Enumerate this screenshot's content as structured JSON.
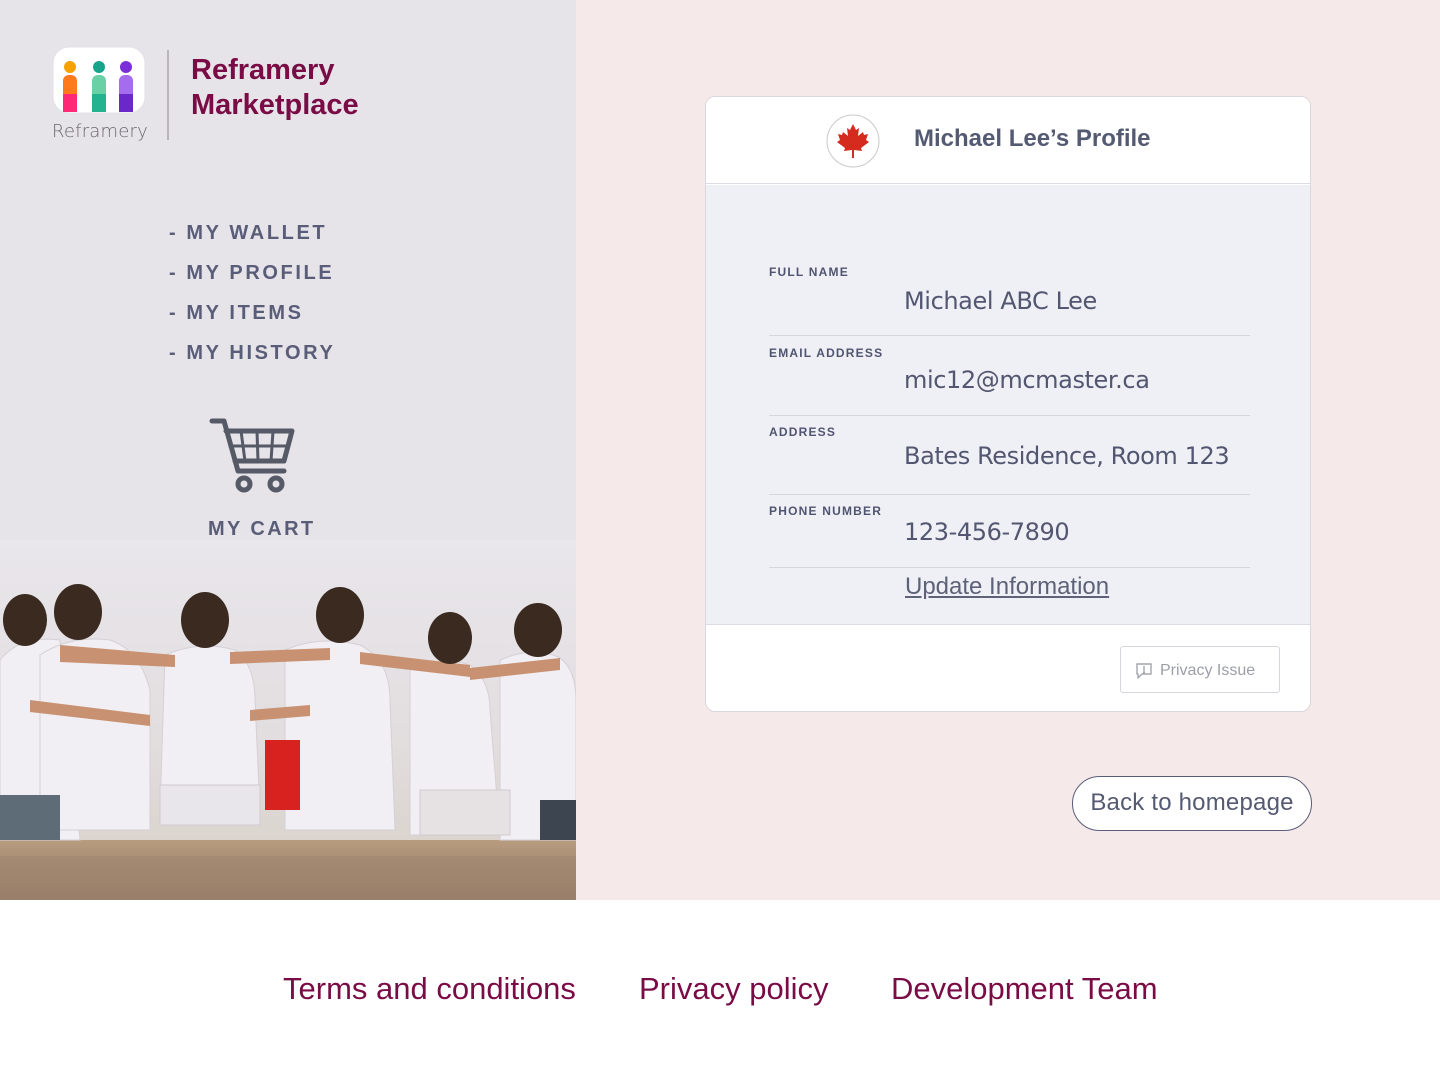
{
  "brand": {
    "logo_word": "Reframery",
    "name_line1": "Reframery",
    "name_line2": "Marketplace"
  },
  "nav": {
    "items": [
      {
        "label": "- MY WALLET"
      },
      {
        "label": "- MY PROFILE"
      },
      {
        "label": "- MY ITEMS"
      },
      {
        "label": "- MY HISTORY"
      }
    ],
    "cart_label": "MY CART",
    "cart_icon": "shopping-cart-icon"
  },
  "profile": {
    "title": "Michael Lee’s Profile",
    "flag_icon": "canada-flag-icon",
    "fields": [
      {
        "label": "FULL NAME",
        "value": "Michael ABC Lee"
      },
      {
        "label": "EMAIL ADDRESS",
        "value": "mic12@mcmaster.ca"
      },
      {
        "label": "ADDRESS",
        "value": "Bates Residence, Room 123"
      },
      {
        "label": "PHONE NUMBER",
        "value": "123-456-7890"
      }
    ],
    "update_link": "Update Information",
    "privacy_button": "Privacy Issue",
    "privacy_icon": "comment-alert-icon"
  },
  "back_button": "Back to homepage",
  "footer": {
    "links": [
      {
        "label": "Terms and conditions"
      },
      {
        "label": "Privacy policy"
      },
      {
        "label": "Development Team"
      }
    ]
  },
  "colors": {
    "brand": "#7a0c45",
    "nav_text": "#5a5d78",
    "left_bg": "#e6e3e9",
    "right_bg": "#f5e9ea",
    "card_body_bg": "#eff0f5"
  }
}
